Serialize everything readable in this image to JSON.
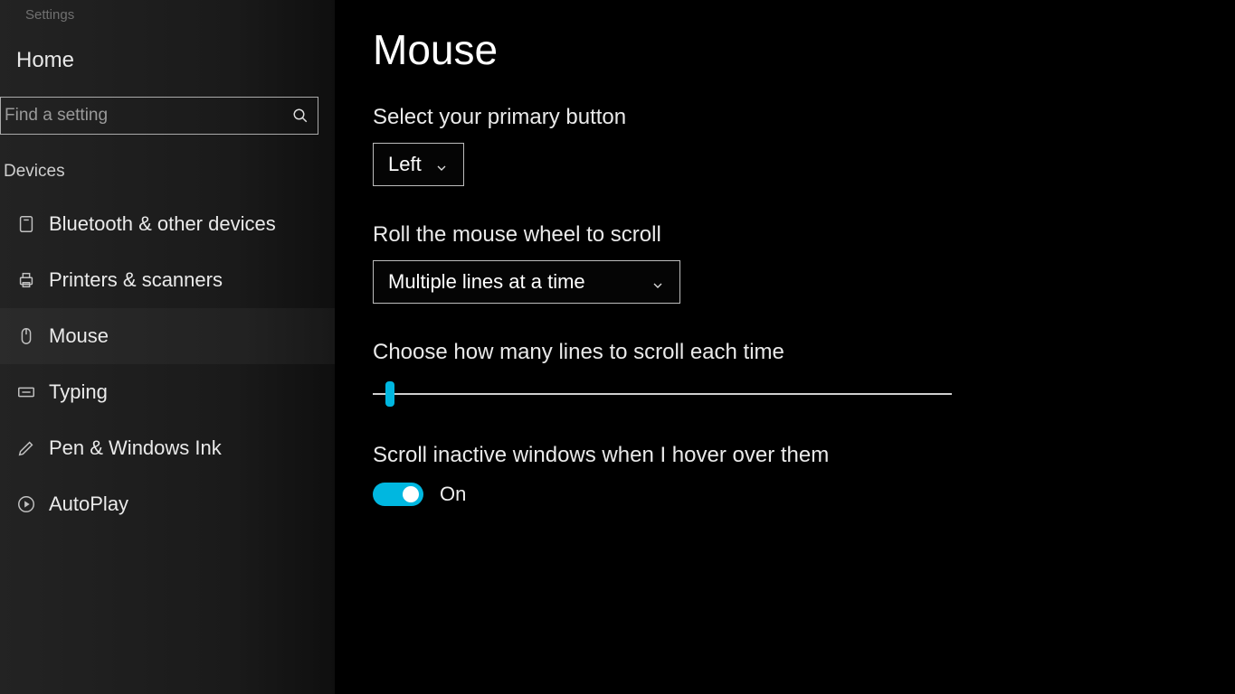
{
  "app": {
    "title": "Settings"
  },
  "sidebar": {
    "home": "Home",
    "search_placeholder": "Find a setting",
    "category": "Devices",
    "items": [
      {
        "label": "Bluetooth & other devices"
      },
      {
        "label": "Printers & scanners"
      },
      {
        "label": "Mouse"
      },
      {
        "label": "Typing"
      },
      {
        "label": "Pen & Windows Ink"
      },
      {
        "label": "AutoPlay"
      }
    ]
  },
  "main": {
    "title": "Mouse",
    "primary_button": {
      "label": "Select your primary button",
      "value": "Left"
    },
    "wheel_scroll": {
      "label": "Roll the mouse wheel to scroll",
      "value": "Multiple lines at a time"
    },
    "lines_slider": {
      "label": "Choose how many lines to scroll each time",
      "position_percent": 3
    },
    "inactive_scroll": {
      "label": "Scroll inactive windows when I hover over them",
      "state_text": "On",
      "on": true
    }
  },
  "colors": {
    "accent": "#00b7e0"
  }
}
